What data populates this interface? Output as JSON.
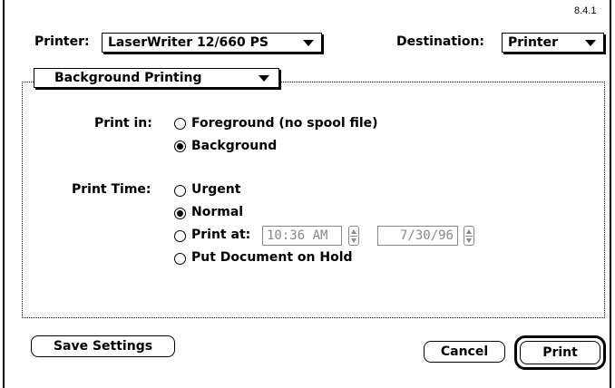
{
  "dialog": {
    "version": "8.4.1",
    "printer_label": "Printer:",
    "printer_value": "LaserWriter 12/660 PS",
    "destination_label": "Destination:",
    "destination_value": "Printer"
  },
  "panel": {
    "selected": "Background Printing"
  },
  "print_in": {
    "label": "Print in:",
    "options": [
      {
        "label": "Foreground (no spool file)",
        "selected": false
      },
      {
        "label": "Background",
        "selected": true
      }
    ]
  },
  "print_time": {
    "label": "Print Time:",
    "options": [
      {
        "label": "Urgent",
        "selected": false
      },
      {
        "label": "Normal",
        "selected": true
      },
      {
        "label": "Print at:",
        "selected": false
      },
      {
        "label": "Put Document on Hold",
        "selected": false
      }
    ],
    "time_value": "10:36 AM",
    "date_value": "7/30/96"
  },
  "buttons": {
    "save_settings": "Save Settings",
    "cancel": "Cancel",
    "print": "Print"
  }
}
